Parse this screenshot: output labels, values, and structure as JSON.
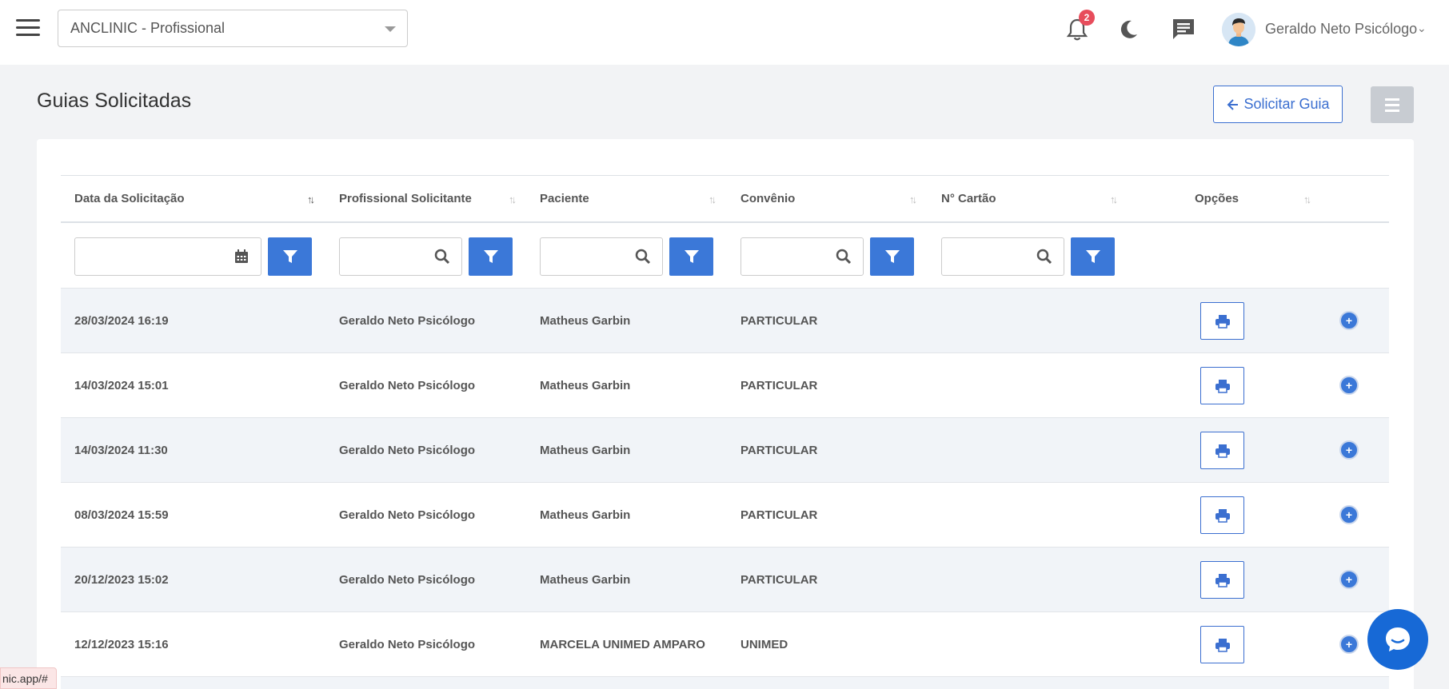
{
  "header": {
    "clinic_select": "ANCLINIC - Profissional",
    "notification_count": "2",
    "user_name": "Geraldo Neto Psicólogo"
  },
  "page": {
    "title": "Guias Solicitadas",
    "solicitar_label": "Solicitar Guia"
  },
  "table": {
    "columns": [
      "Data da Solicitação",
      "Profissional Solicitante",
      "Paciente",
      "Convênio",
      "N° Cartão",
      "Opções"
    ],
    "rows": [
      {
        "data": "28/03/2024 16:19",
        "profissional": "Geraldo Neto Psicólogo",
        "paciente": "Matheus Garbin",
        "convenio": "PARTICULAR",
        "cartao": ""
      },
      {
        "data": "14/03/2024 15:01",
        "profissional": "Geraldo Neto Psicólogo",
        "paciente": "Matheus Garbin",
        "convenio": "PARTICULAR",
        "cartao": ""
      },
      {
        "data": "14/03/2024 11:30",
        "profissional": "Geraldo Neto Psicólogo",
        "paciente": "Matheus Garbin",
        "convenio": "PARTICULAR",
        "cartao": ""
      },
      {
        "data": "08/03/2024 15:59",
        "profissional": "Geraldo Neto Psicólogo",
        "paciente": "Matheus Garbin",
        "convenio": "PARTICULAR",
        "cartao": ""
      },
      {
        "data": "20/12/2023 15:02",
        "profissional": "Geraldo Neto Psicólogo",
        "paciente": "Matheus Garbin",
        "convenio": "PARTICULAR",
        "cartao": ""
      },
      {
        "data": "12/12/2023 15:16",
        "profissional": "Geraldo Neto Psicólogo",
        "paciente": "MARCELA UNIMED AMPARO",
        "convenio": "UNIMED",
        "cartao": ""
      }
    ]
  },
  "status_url": "nic.app/#",
  "colors": {
    "accent": "#3b78d8",
    "badge": "#e74c5b",
    "chat_widget": "#1769d6"
  }
}
